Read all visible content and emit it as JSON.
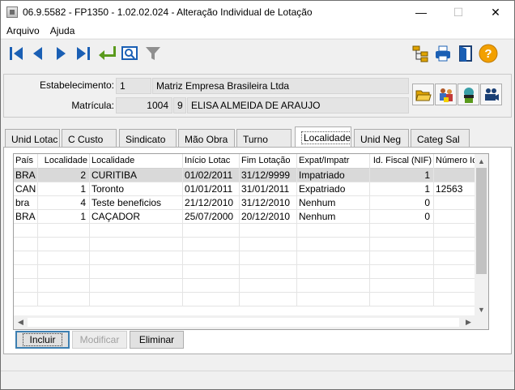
{
  "window": {
    "title": "06.9.5582 - FP1350 - 1.02.02.024 - Alteração Individual de Lotação",
    "minimize_glyph": "—",
    "maximize_glyph": "☐",
    "close_glyph": "✕"
  },
  "menu": {
    "items": [
      "Arquivo",
      "Ajuda"
    ]
  },
  "toolbar": {
    "left_icons": [
      "first-record-icon",
      "previous-record-icon",
      "next-record-icon",
      "last-record-icon",
      "return-icon",
      "preview-icon",
      "filter-icon"
    ],
    "right_icons": [
      "tree-icon",
      "print-icon",
      "exit-door-icon",
      "help-icon"
    ],
    "help_glyph": "?"
  },
  "header": {
    "estabelecimento_label": "Estabelecimento:",
    "estabelecimento_code": "1",
    "estabelecimento_name": "Matriz Empresa Brasileira Ltda",
    "matricula_label": "Matrícula:",
    "matricula_number": "1004",
    "matricula_digit": "9",
    "employee_name": "ELISA ALMEIDA DE ARAUJO",
    "side_buttons": [
      "open-folder-icon",
      "people-icon",
      "person-search-icon",
      "camera-icon"
    ]
  },
  "tabs": {
    "items": [
      "Unid Lotac",
      "C Custo",
      "Sindicato",
      "Mão Obra",
      "Turno",
      "Localidade",
      "Unid Neg",
      "Categ Sal"
    ],
    "active": "Localidade"
  },
  "grid": {
    "columns": [
      "País",
      "Localidade",
      "Localidade",
      "Início Lotac",
      "Fim Lotação",
      "Expat/Impatr",
      "Id. Fiscal (NIF)",
      "Número Id"
    ],
    "rows": [
      [
        "BRA",
        "2",
        "CURITIBA",
        "01/02/2011",
        "31/12/9999",
        "Impatriado",
        "1",
        ""
      ],
      [
        "CAN",
        "1",
        "Toronto",
        "01/01/2011",
        "31/01/2011",
        "Expatriado",
        "1",
        "12563"
      ],
      [
        "bra",
        "4",
        "Teste beneficios",
        "21/12/2010",
        "31/12/2010",
        "Nenhum",
        "0",
        ""
      ],
      [
        "BRA",
        "1",
        "CAÇADOR",
        "25/07/2000",
        "20/12/2010",
        "Nenhum",
        "0",
        ""
      ]
    ],
    "selected_row": 0
  },
  "buttons": {
    "incluir": "Incluir",
    "modificar": "Modificar",
    "eliminar": "Eliminar"
  },
  "colors": {
    "nav_blue": "#1a5fb4",
    "return_green": "#5a9a1c",
    "help_orange": "#f2a000"
  }
}
